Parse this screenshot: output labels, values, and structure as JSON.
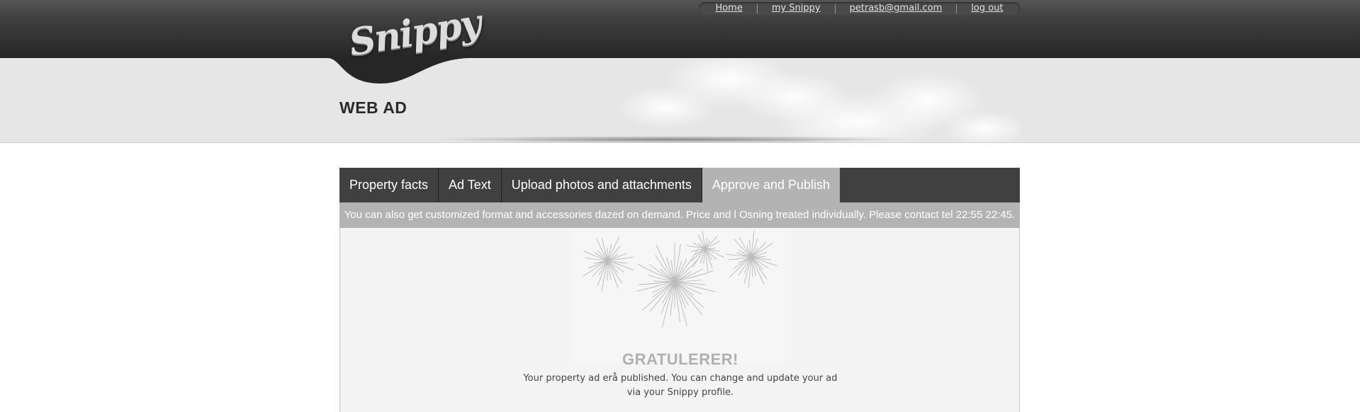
{
  "header": {
    "logo_text": "Snippy",
    "nav": [
      {
        "label": "Home"
      },
      {
        "label": "my Snippy"
      },
      {
        "label": "petrasb@gmail.com"
      },
      {
        "label": "log out"
      }
    ]
  },
  "banner": {
    "title": "WEB AD"
  },
  "tabs": [
    {
      "label": "Property facts",
      "active": false
    },
    {
      "label": "Ad Text",
      "active": false
    },
    {
      "label": "Upload photos and attachments",
      "active": false
    },
    {
      "label": "Approve and Publish",
      "active": true
    }
  ],
  "notice": "You can also get customized format and accessories dazed on demand. Price and l Osning treated individually. Please contact tel 22:55 22:45.",
  "success": {
    "heading": "GRATULERER!",
    "message_line1": "Your property ad erå published. You can change and update your ad",
    "message_line2": "via your Snippy profile."
  },
  "colors": {
    "topbar": "#3e3e3e",
    "banner": "#e6e6e6",
    "tab_bar": "#404040",
    "tab_active": "#b3b3b3"
  }
}
